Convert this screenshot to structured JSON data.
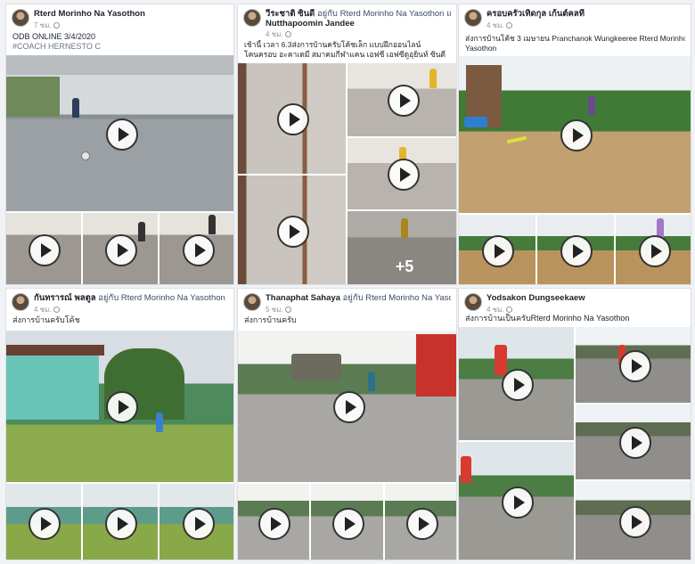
{
  "posts": [
    {
      "author": "Rterd Morinho Na Yasothon",
      "action": "",
      "time": "7 ชม.",
      "lines": [
        "ODB ONLINE 3/4/2020",
        "#COACH HERNESTO C"
      ]
    },
    {
      "author": "วีระชาติ ซินดี",
      "action": "อยู่กับ Rterd Morinho Na Yasothon และ",
      "second_line": "Nutthapoomin Jandee",
      "time": "4 ชม.",
      "lines": [
        "เช้านี้ เวลา 6.3ส่งการบ้านครับโค้ชเล็ก แบบฝึกออนไลน์",
        "โคนครอบ อะคาเดมี่ สมาคมกีฬาแคน เอฟซี เอฟซีดูอุยินท์ ซินดี"
      ],
      "more_count": "+5"
    },
    {
      "author": "ครอบครัวเทิดกุล เก้นต์คลที",
      "action": "",
      "time": "4 ชม.",
      "lines": [
        "ส่งการบ้านโค้ช 3 เมษายน Pranchanok Wungkeeree Rterd Morinho Na",
        "Yasothon"
      ]
    },
    {
      "author": "กันทรารณ์ พลตูล",
      "action": "อยู่กับ Rterd Morinho Na Yasothon",
      "time": "4 ชม.",
      "lines": [
        "ส่งการบ้านครับโค้ช"
      ]
    },
    {
      "author": "Thanaphat Sahaya",
      "action": "อยู่กับ Rterd Morinho Na Yasothon",
      "time": "5 ชม.",
      "lines": [
        "ส่งการบ้านครับ"
      ]
    },
    {
      "author": "Yodsakon Dungseekaew",
      "action": "",
      "time": "4 ชม.",
      "lines": [
        "ส่งการบ้านเป็นครับRterd Morinho Na Yasothon"
      ]
    }
  ]
}
